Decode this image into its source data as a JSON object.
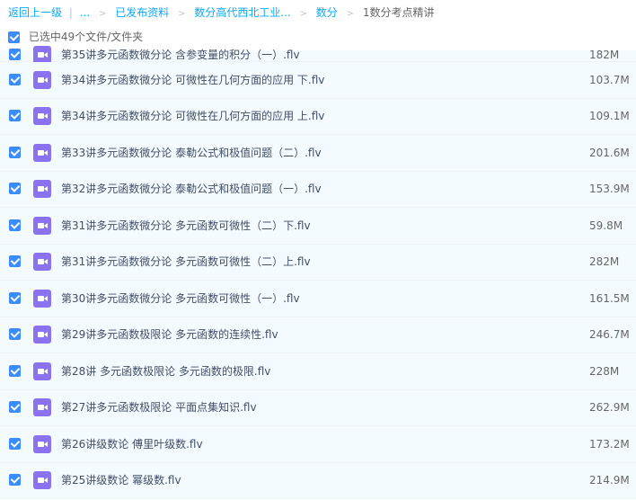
{
  "breadcrumb": {
    "back": "返回上一级",
    "sep": "|",
    "ellipsis": "...",
    "crumbs": [
      "已发布资料",
      "数分高代西北工业...",
      "数分"
    ],
    "current": "1数分考点精讲",
    "arrow": ">"
  },
  "selection": {
    "label": "已选中49个文件/文件夹"
  },
  "file_icon": "video-file-icon",
  "files": [
    {
      "name": "第35讲多元函数微分论 含参变量的积分（一）.flv",
      "size": "182M"
    },
    {
      "name": "第34讲多元函数微分论 可微性在几何方面的应用 下.flv",
      "size": "103.7M"
    },
    {
      "name": "第34讲多元函数微分论 可微性在几何方面的应用 上.flv",
      "size": "109.1M"
    },
    {
      "name": "第33讲多元函数微分论 泰勒公式和极值问题（二）.flv",
      "size": "201.6M"
    },
    {
      "name": "第32讲多元函数微分论 泰勒公式和极值问题（一）.flv",
      "size": "153.9M"
    },
    {
      "name": "第31讲多元函数微分论 多元函数可微性（二）下.flv",
      "size": "59.8M"
    },
    {
      "name": "第31讲多元函数微分论 多元函数可微性（二）上.flv",
      "size": "282M"
    },
    {
      "name": "第30讲多元函数微分论 多元函数可微性（一）.flv",
      "size": "161.5M"
    },
    {
      "name": "第29讲多元函数极限论 多元函数的连续性.flv",
      "size": "246.7M"
    },
    {
      "name": "第28讲 多元函数极限论 多元函数的极限.flv",
      "size": "228M"
    },
    {
      "name": "第27讲多元函数极限论 平面点集知识.flv",
      "size": "262.9M"
    },
    {
      "name": "第26讲级数论 傅里叶级数.flv",
      "size": "173.2M"
    },
    {
      "name": "第25讲级数论 幂级数.flv",
      "size": "214.9M"
    }
  ],
  "colors": {
    "link": "#09aaff",
    "checkbox": "#3b8cff",
    "row_bg": "#f4fbff",
    "icon": "#8a72f0"
  }
}
